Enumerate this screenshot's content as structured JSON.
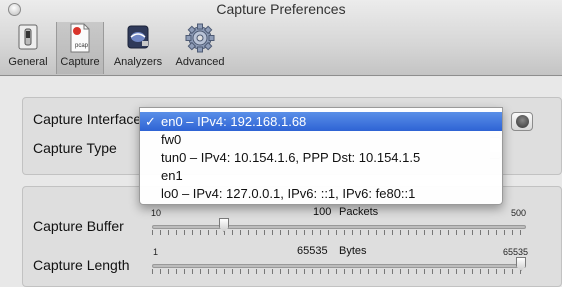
{
  "window": {
    "title": "Capture Preferences"
  },
  "toolbar": {
    "items": [
      {
        "label": "General",
        "icon": "switch-icon"
      },
      {
        "label": "Capture",
        "icon": "pcap-document-icon",
        "badge": "pcap"
      },
      {
        "label": "Analyzers",
        "icon": "analyzer-icon"
      },
      {
        "label": "Advanced",
        "icon": "gear-icon"
      }
    ],
    "selected": "Capture"
  },
  "capture": {
    "interface_label": "Capture Interface",
    "type_label": "Capture Type",
    "interface_menu": {
      "checkmark": "✓",
      "options": [
        "en0 – IPv4: 192.168.1.68",
        "fw0",
        "tun0 – IPv4: 10.154.1.6, PPP Dst: 10.154.1.5",
        "en1",
        "lo0 – IPv4: 127.0.0.1, IPv6: ::1, IPv6: fe80::1"
      ],
      "selected_index": 0
    }
  },
  "buffer": {
    "label": "Capture Buffer",
    "min": "10",
    "max": "500",
    "value": "100",
    "unit": "Packets",
    "level": 0.184
  },
  "length": {
    "label": "Capture Length",
    "min": "1",
    "max": "65535",
    "value": "65535",
    "unit": "Bytes",
    "level": 1.0
  },
  "colors": {
    "selection": "#3a6fdc",
    "toolbar_bg": "#d6d6d6",
    "window_bg": "#e8e8e8"
  }
}
